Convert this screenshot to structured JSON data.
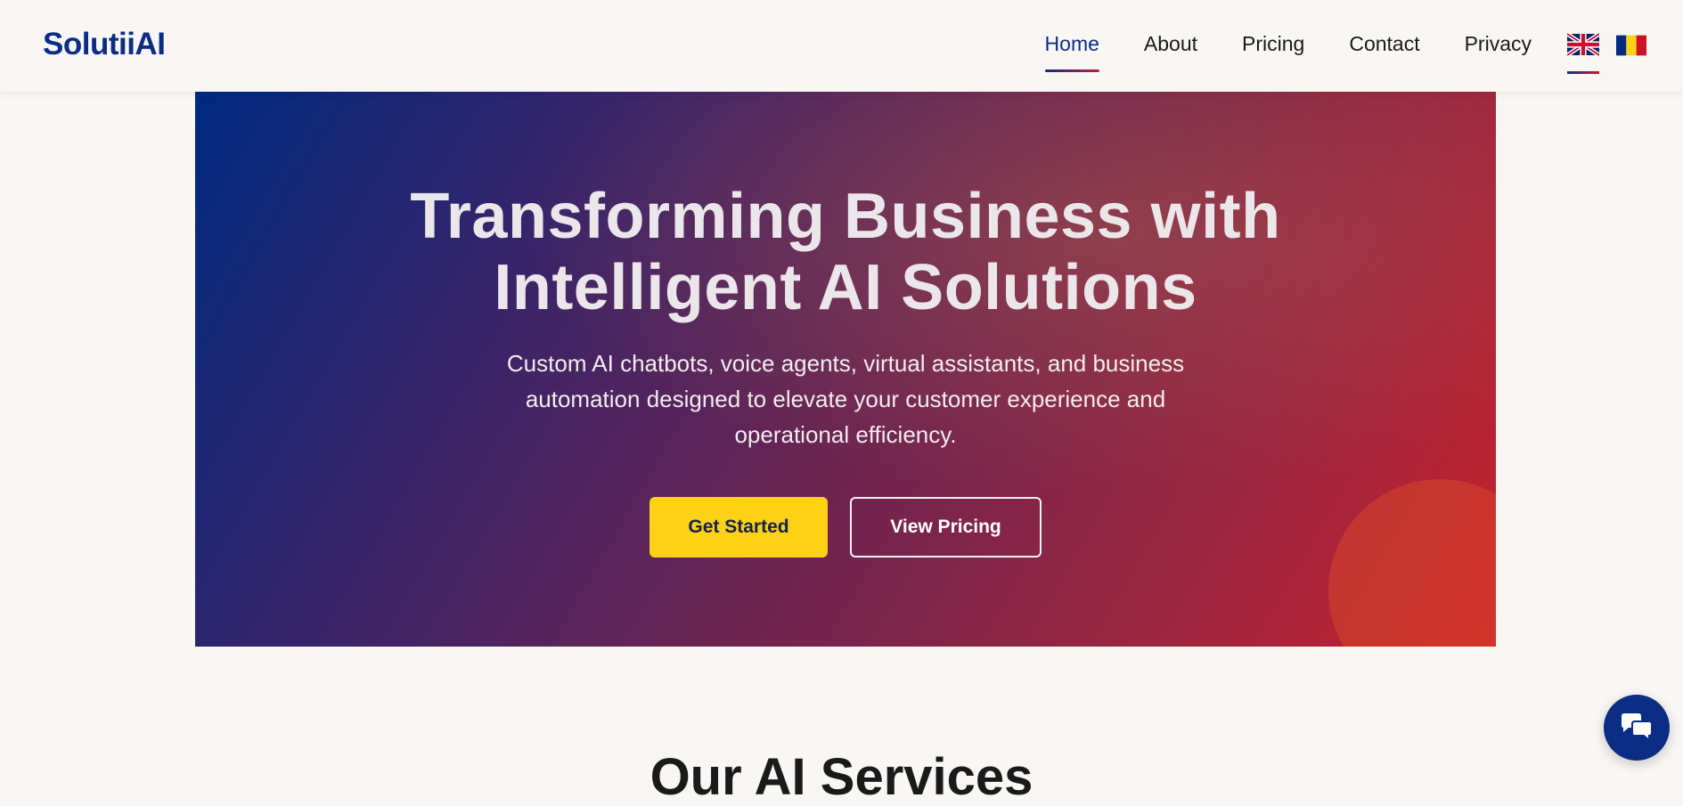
{
  "brand": {
    "name": "SolutiiAI",
    "primary_color": "#0c2d84",
    "accent_color": "#c41e3a",
    "cta_color": "#fcd116"
  },
  "nav": {
    "items": [
      {
        "label": "Home",
        "active": true
      },
      {
        "label": "About",
        "active": false
      },
      {
        "label": "Pricing",
        "active": false
      },
      {
        "label": "Contact",
        "active": false
      },
      {
        "label": "Privacy",
        "active": false
      }
    ],
    "languages": [
      {
        "icon": "uk-flag-icon",
        "active": true
      },
      {
        "icon": "romania-flag-icon",
        "active": false
      }
    ]
  },
  "hero": {
    "title_line1": "Transforming Business with",
    "title_line2": "Intelligent AI Solutions",
    "subtitle": "Custom AI chatbots, voice agents, virtual assistants, and business automation designed to elevate your customer experience and operational efficiency.",
    "primary_button": "Get Started",
    "secondary_button": "View Pricing"
  },
  "services": {
    "title": "Our AI Services"
  },
  "chat_widget": {
    "icon": "chat-bubbles-icon"
  }
}
